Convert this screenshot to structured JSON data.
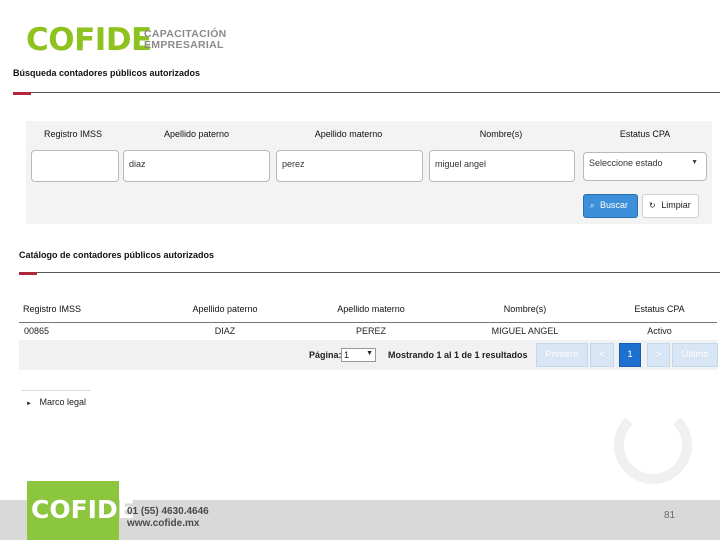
{
  "header": {
    "brand": "COFIDE",
    "brand_sub_line1": "CAPACITACIÓN",
    "brand_sub_line2": "EMPRESARIAL"
  },
  "search": {
    "title": "Búsqueda contadores públicos autorizados",
    "columns": [
      "Registro IMSS",
      "Apellido paterno",
      "Apellido materno",
      "Nombre(s)",
      "Estatus CPA"
    ],
    "values": {
      "registro_imss": "",
      "apellido_paterno": "diaz",
      "apellido_materno": "perez",
      "nombres": "miguel angel"
    },
    "estatus_selected": "Seleccione estado",
    "buscar_label": "Buscar",
    "limpiar_label": "Limpiar"
  },
  "catalog": {
    "title": "Catálogo de contadores públicos autorizados",
    "columns": [
      "Registro IMSS",
      "Apellido paterno",
      "Apellido materno",
      "Nombre(s)",
      "Estatus CPA"
    ],
    "rows": [
      [
        "00865",
        "DIAZ",
        "PEREZ",
        "MIGUEL ANGEL",
        "Activo"
      ]
    ],
    "pager": {
      "pagina_label": "Página:",
      "pagina_value": "1",
      "summary": "Mostrando 1 al 1 de 1 resultados",
      "first": "Primero",
      "prev": "<",
      "current": "1",
      "next": ">",
      "last": "Último"
    }
  },
  "links": {
    "marco_legal": "Marco legal"
  },
  "footer": {
    "logo": "COFIDE",
    "phone": "01 (55) 4630.4646",
    "web": "www.cofide.mx",
    "page_number": "81"
  },
  "colors": {
    "brand_green": "#8ec31f",
    "accent_red": "#b0263a",
    "button_blue": "#3c8fd8"
  }
}
